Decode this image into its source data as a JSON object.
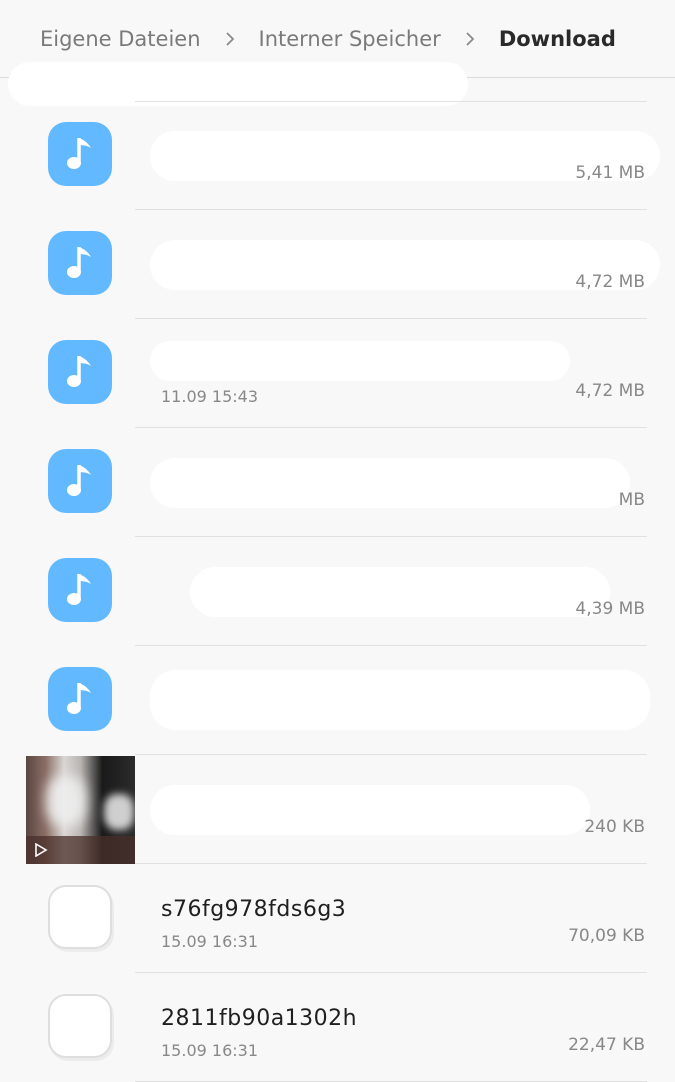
{
  "breadcrumb": {
    "items": [
      "Eigene Dateien",
      "Interner Speicher",
      "Download"
    ]
  },
  "icons": {
    "music": "music-note-icon",
    "separator": "chevron-right-icon",
    "play": "play-icon"
  },
  "colors": {
    "music_icon_bg": "#63b9ff",
    "background": "#f8f8f8"
  },
  "files": [
    {
      "type": "audio",
      "name": "",
      "date": "",
      "size": "5,41 MB"
    },
    {
      "type": "audio",
      "name": "",
      "date": "",
      "size": "4,72 MB"
    },
    {
      "type": "audio",
      "name": "",
      "date": "11.09 15:43",
      "size": "4,72 MB"
    },
    {
      "type": "audio",
      "name": "",
      "date": "",
      "size": "MB"
    },
    {
      "type": "audio",
      "name": "",
      "date": "",
      "size": "4,39 MB"
    },
    {
      "type": "audio",
      "name": "",
      "date": "",
      "size": ""
    },
    {
      "type": "video",
      "name": "",
      "date": "",
      "size": "240 KB"
    },
    {
      "type": "file",
      "name": "s76fg978fds6g3",
      "date": "15.09 16:31",
      "size": "70,09 KB"
    },
    {
      "type": "file",
      "name": "2811fb90a1302h",
      "date": "15.09 16:31",
      "size": "22,47 KB"
    }
  ]
}
